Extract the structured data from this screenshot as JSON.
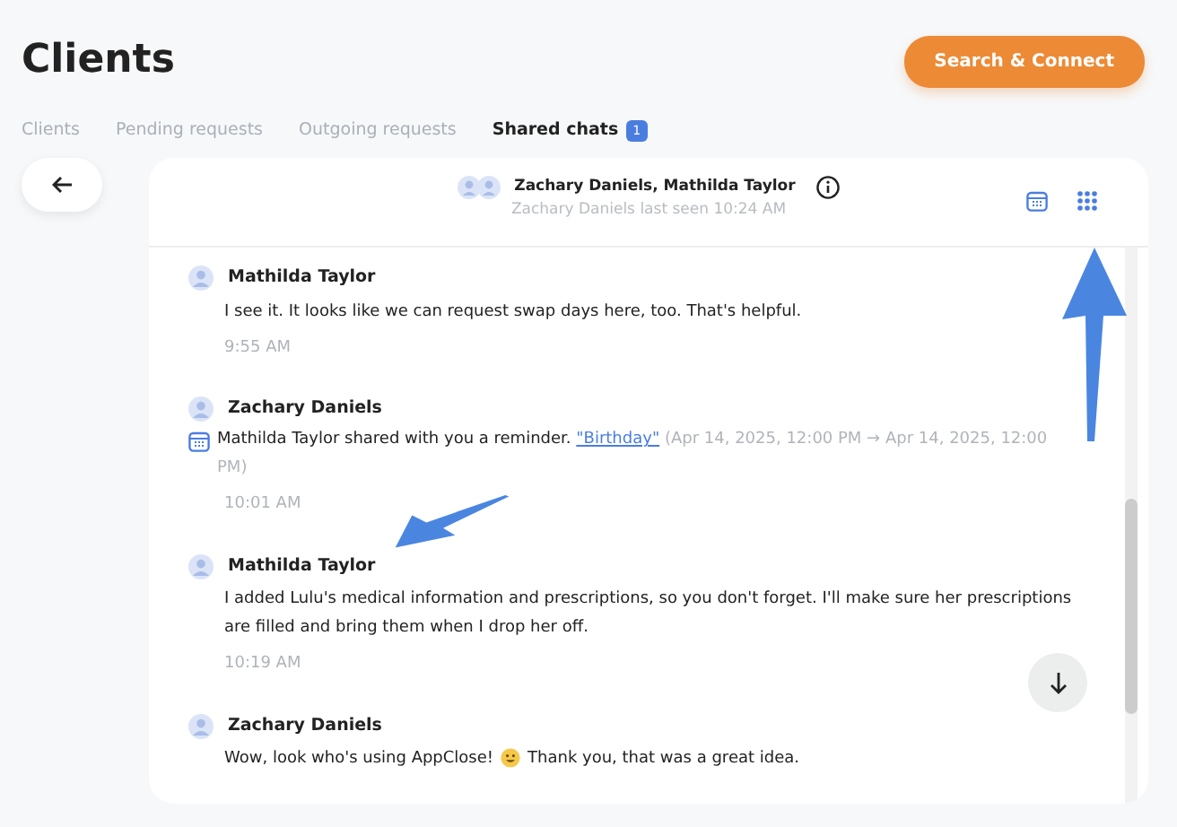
{
  "page": {
    "title": "Clients",
    "action_button": "Search & Connect"
  },
  "tabs": [
    {
      "label": "Clients",
      "selected": false
    },
    {
      "label": "Pending requests",
      "selected": false
    },
    {
      "label": "Outgoing requests",
      "selected": false
    },
    {
      "label": "Shared chats",
      "selected": true,
      "badge": "1"
    }
  ],
  "chat": {
    "participants": "Zachary Daniels, Mathilda Taylor",
    "last_seen": "Zachary Daniels last seen 10:24 AM",
    "messages": [
      {
        "kind": "text",
        "sender": "Mathilda Taylor",
        "text": "I see it. It looks like we can request swap days here, too. That's helpful.",
        "time": "9:55 AM"
      },
      {
        "kind": "reminder",
        "sender": "Zachary Daniels",
        "text": "Mathilda Taylor shared with you a reminder.",
        "link": "\"Birthday\"",
        "detail": "(Apr 14, 2025, 12:00 PM → Apr 14, 2025, 12:00 PM)",
        "time": "10:01 AM"
      },
      {
        "kind": "text",
        "sender": "Mathilda Taylor",
        "text": "I added Lulu's medical information and prescriptions, so you don't forget. I'll make sure her prescriptions are filled and bring them when I drop her off.",
        "time": "10:19 AM"
      },
      {
        "kind": "emoji",
        "sender": "Zachary Daniels",
        "text": "Wow, look who's using AppClose!",
        "text_after": "Thank you, that was a great idea."
      }
    ]
  }
}
